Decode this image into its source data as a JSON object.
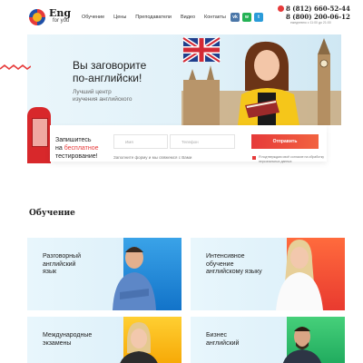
{
  "header": {
    "logo_name": "Eng",
    "logo_sub": "for you",
    "nav": [
      "Обучение",
      "Цены",
      "Преподаватели",
      "Видео",
      "Контакты"
    ],
    "social": [
      {
        "name": "vk-icon",
        "glyph": "vk",
        "color": "#4a76a8"
      },
      {
        "name": "whatsapp-icon",
        "glyph": "w",
        "color": "#25b255"
      },
      {
        "name": "telegram-icon",
        "glyph": "t",
        "color": "#2a9bd9"
      }
    ],
    "phones": [
      "8 (812) 660-52-44",
      "8 (800) 200-06-12"
    ],
    "hours": "ежедневно с 11:00 до 21:00"
  },
  "hero": {
    "title_line1": "Вы заговорите",
    "title_line2": "по-английски!",
    "subtitle_line1": "Лучший центр",
    "subtitle_line2": "изучения английского"
  },
  "form": {
    "title_line1": "Запишитесь",
    "title_line2_pre": "на ",
    "title_line2_accent": "бесплатное",
    "title_line3": "тестирование!",
    "name_placeholder": "Имя",
    "phone_placeholder": "Телефон",
    "submit_label": "Отправить",
    "note": "Заполните форму и мы свяжемся с Вами",
    "consent": "Я подтверждаю своё согласие на обработку персональных данных"
  },
  "section": {
    "title": "Обучение"
  },
  "courses": [
    {
      "line1": "Разговорный",
      "line2": "английский",
      "line3": "язык"
    },
    {
      "line1": "Интенсивное",
      "line2": "обучение",
      "line3": "английскому языку"
    },
    {
      "line1": "Международные",
      "line2": "экзамены",
      "line3": ""
    },
    {
      "line1": "Бизнес",
      "line2": "английский",
      "line3": ""
    }
  ],
  "colors": {
    "accent": "#e63a3a",
    "hero_bg": "#e3f2f9"
  }
}
